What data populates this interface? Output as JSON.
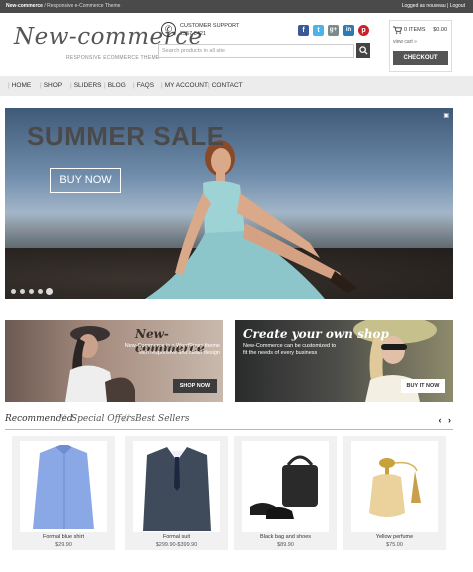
{
  "topbar": {
    "site": "New-commerce",
    "sep": " / ",
    "tag": "Responsive e-Commerce Theme",
    "login": "Logged as nouveau | Logout"
  },
  "header": {
    "logo": "New-commerce",
    "tagline": "RESPONSIVE ECOMMERCE THEME",
    "support_label": "CUSTOMER SUPPORT",
    "support_number": "2357 8421",
    "search_placeholder": "Search products in all site",
    "socials": [
      {
        "name": "facebook",
        "glyph": "f",
        "color": "#3b5998"
      },
      {
        "name": "twitter",
        "glyph": "t",
        "color": "#4bb3e8"
      },
      {
        "name": "google-plus",
        "glyph": "g+",
        "color": "#7c8b8a"
      },
      {
        "name": "linkedin",
        "glyph": "in",
        "color": "#2d7bb4"
      },
      {
        "name": "pinterest",
        "glyph": "p",
        "color": "#cc2127"
      }
    ]
  },
  "cart": {
    "items": "0 ITEMS",
    "total": "$0.00",
    "view_cart": "view cart »",
    "checkout": "CHECKOUT"
  },
  "nav": [
    "HOME",
    "SHOP",
    "SLIDERS",
    "BLOG",
    "FAQS",
    "MY ACCOUNT",
    "CONTACT"
  ],
  "hero": {
    "title": "SUMMER SALE",
    "button": "BUY NOW",
    "slide_count": 5,
    "active_slide": 5
  },
  "promos": [
    {
      "title": "New-commerce",
      "text": "New-Commerce is a WordPress theme with responsive and clean design",
      "button": "SHOP NOW"
    },
    {
      "title": "Create your own shop",
      "text": "New-Commerce can be customized to fit the needs of every business",
      "button": "BUY IT NOW"
    }
  ],
  "tabs": [
    "Recommended",
    "Special Offers",
    "Best Sellers"
  ],
  "tab_separator": "//",
  "products": [
    {
      "name": "Formal blue shirt",
      "price": "$29.90"
    },
    {
      "name": "Formal suit",
      "price": "$299.90-$399.90"
    },
    {
      "name": "Black bag and shoes",
      "price": "$89.90"
    },
    {
      "name": "Yellow perfume",
      "price": "$75.00"
    }
  ]
}
